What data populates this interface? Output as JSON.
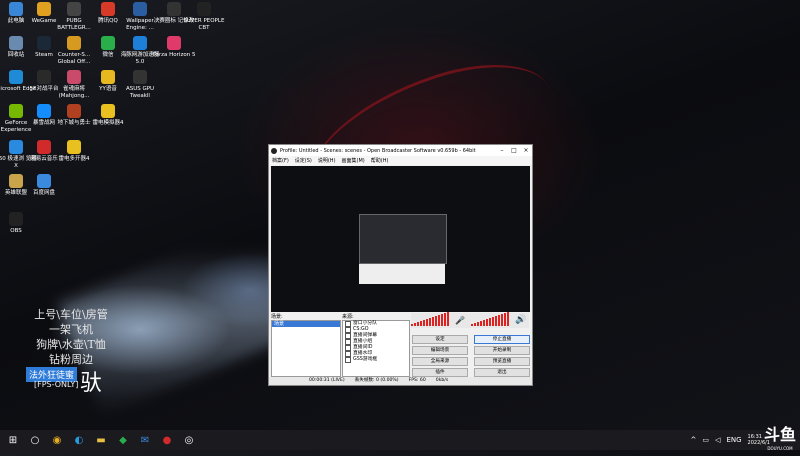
{
  "desktop": {
    "icons": [
      {
        "label": "此电脑",
        "icon": "computer-icon",
        "color": "#3a86d6"
      },
      {
        "label": "WeGame",
        "icon": "wegame-icon",
        "color": "#e0a020"
      },
      {
        "label": "PUBG BATTLEGR...",
        "icon": "pubg-icon",
        "color": "#444444"
      },
      {
        "label": "腾讯QQ",
        "icon": "qq-icon",
        "color": "#d83a2a"
      },
      {
        "label": "Wallpaper Engine: ...",
        "icon": "wallpaper-engine-icon",
        "color": "#2a5ea0"
      },
      {
        "label": "决赛圈标 记修改",
        "icon": "marker-icon",
        "color": "#333333"
      },
      {
        "label": "SUPER PEOPLE CBT",
        "icon": "super-people-icon",
        "color": "#222222"
      },
      {
        "label": "回收站",
        "icon": "recycle-bin-icon",
        "color": "#6a8ab0"
      },
      {
        "label": "Steam",
        "icon": "steam-icon",
        "color": "#1b2838"
      },
      {
        "label": "Counter-S... Global Off...",
        "icon": "csgo-icon",
        "color": "#d69a20"
      },
      {
        "label": "微信",
        "icon": "wechat-icon",
        "color": "#2aae4a"
      },
      {
        "label": "海豚网游加速器5.0",
        "icon": "dolphin-accelerator-icon",
        "color": "#1e7fd8"
      },
      {
        "label": "Forza Horizon 5",
        "icon": "forza-icon",
        "color": "#e03a6a"
      },
      {
        "label": "Microsoft Edge",
        "icon": "edge-icon",
        "color": "#1f8ad6"
      },
      {
        "label": "5E对战平台",
        "icon": "5e-icon",
        "color": "#2a2a2a"
      },
      {
        "label": "雀魂麻将 (Mahjong...",
        "icon": "mahjong-icon",
        "color": "#c94a6a"
      },
      {
        "label": "YY语音",
        "icon": "yy-icon",
        "color": "#e8b820"
      },
      {
        "label": "ASUS GPU Tweakll",
        "icon": "asus-gpu-icon",
        "color": "#333333"
      },
      {
        "label": "GeForce Experience",
        "icon": "geforce-icon",
        "color": "#76b900"
      },
      {
        "label": "暴雪战网",
        "icon": "battlenet-icon",
        "color": "#148eff"
      },
      {
        "label": "地下城与勇士",
        "icon": "dnf-icon",
        "color": "#b04020"
      },
      {
        "label": "雷电模拟器4",
        "icon": "ldplayer-icon",
        "color": "#e8c020"
      },
      {
        "label": "360 极速浏 览器X",
        "icon": "360-browser-icon",
        "color": "#2a8ae0"
      },
      {
        "label": "网易云音乐",
        "icon": "netease-music-icon",
        "color": "#d02a2a"
      },
      {
        "label": "雷电多开器4",
        "icon": "ldmulti-icon",
        "color": "#e8c020"
      },
      {
        "label": "英雄联盟",
        "icon": "lol-icon",
        "color": "#c9a44a"
      },
      {
        "label": "百度网盘",
        "icon": "baidu-netdisk-icon",
        "color": "#3a8ae0"
      },
      {
        "label": "OBS",
        "icon": "obs-icon",
        "color": "#222222"
      }
    ]
  },
  "overlay": {
    "lines": [
      "上号\\车位\\房管",
      "一架飞机",
      "狗牌\\水壶\\T恤",
      "钻粉周边"
    ],
    "badge": "法外狂徒蜜",
    "fps": "[FPS-ONLY]",
    "big_char": "驮"
  },
  "obs": {
    "title": "Profile: Untitled - Scenes: scenes - Open Broadcaster Software v0.659b - 64bit",
    "menu": [
      "档案(F)",
      "设定(S)",
      "说明(H)",
      "画面集(M)",
      "帮助(H)"
    ],
    "scenes_label": "场景:",
    "sources_label": "来源:",
    "scene_selected": "场景",
    "sources": [
      "窗口小分队",
      "CS:GO",
      "直播间弹幕",
      "直播小组",
      "直播间ID",
      "直播水印",
      "GSS游戏框"
    ],
    "buttons": [
      "设定",
      "停止直播",
      "编辑场景",
      "开始录制",
      "全局来源",
      "预览直播",
      "插件",
      "退出"
    ],
    "status": [
      "00:00:31 (LIVE)",
      "丢失帧数: 0 (0.00%)",
      "FPS: 60",
      "0kb/s"
    ]
  },
  "taskbar": {
    "items": [
      "start-icon",
      "search-icon",
      "chrome-icon",
      "edge-icon",
      "explorer-icon",
      "wechat-icon",
      "mail-icon",
      "netease-icon",
      "obs-icon"
    ],
    "lang": "ENG",
    "time": "16:31",
    "date": "2022/6/1"
  },
  "watermark": {
    "main": "斗鱼",
    "sub": "DOUYU.COM"
  }
}
